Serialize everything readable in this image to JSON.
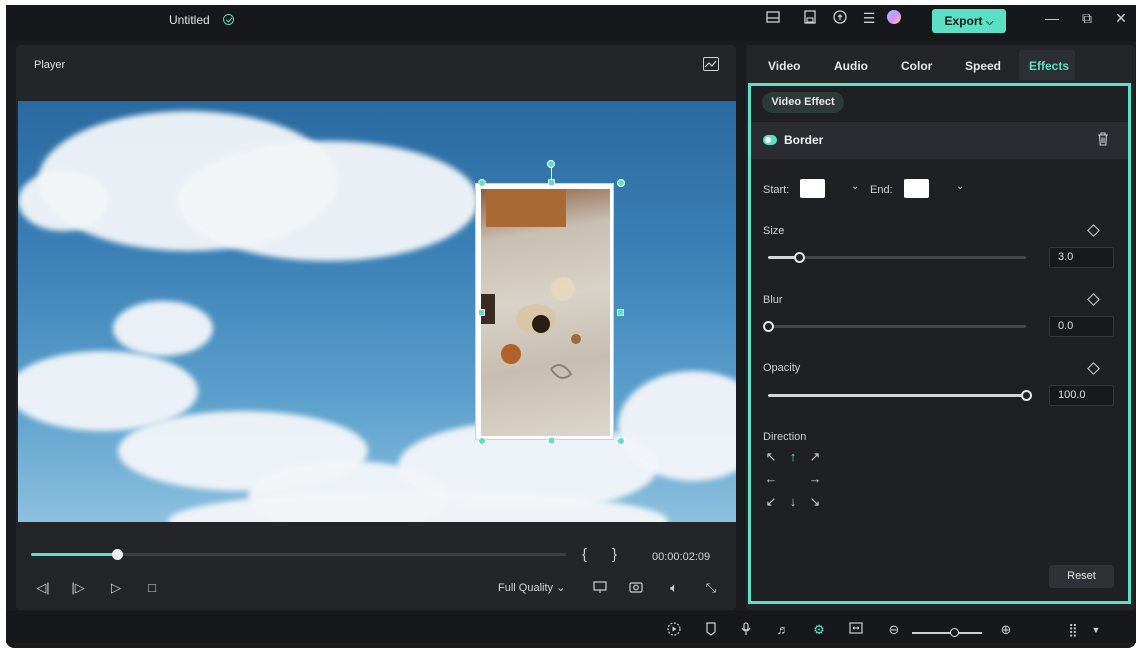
{
  "window": {
    "title": "Untitled",
    "export_label": "Export",
    "export_caret": "⌵",
    "icons": [
      "layout-icon",
      "save-icon",
      "cloud-upload-icon",
      "menu-icon",
      "avatar-icon"
    ],
    "controls": {
      "minimize": "—",
      "maximize": "⧉",
      "close": "✕"
    }
  },
  "player": {
    "label": "Player",
    "timecode": "00:00:02:09",
    "progress_fraction": 0.16,
    "bracket_open": "{",
    "bracket_close": "}",
    "quality": "Full Quality",
    "quality_caret": "⌄"
  },
  "tabs": [
    {
      "label": "Video",
      "active": false
    },
    {
      "label": "Audio",
      "active": false
    },
    {
      "label": "Color",
      "active": false
    },
    {
      "label": "Speed",
      "active": false
    },
    {
      "label": "Effects",
      "active": true
    }
  ],
  "effects": {
    "chip": "Video Effect",
    "name": "Border",
    "enabled": true,
    "start_label": "Start:",
    "end_label": "End:",
    "start_color": "#ffffff",
    "end_color": "#ffffff",
    "sliders": [
      {
        "label": "Size",
        "value": "3.0",
        "fraction": 0.12
      },
      {
        "label": "Blur",
        "value": "0.0",
        "fraction": 0.0
      },
      {
        "label": "Opacity",
        "value": "100.0",
        "fraction": 1.0
      }
    ],
    "direction_label": "Direction",
    "direction_active": "up",
    "reset_label": "Reset"
  },
  "colors": {
    "accent": "#5ce0c5",
    "background": "#191b1f"
  },
  "bottom_toolbar": {
    "icons": [
      "render-preview-icon",
      "marker-icon",
      "microphone-icon",
      "audio-track-icon",
      "ai-split-icon",
      "fit-icon",
      "zoom-out-icon",
      "zoom-in-icon",
      "grid-menu-icon"
    ]
  }
}
